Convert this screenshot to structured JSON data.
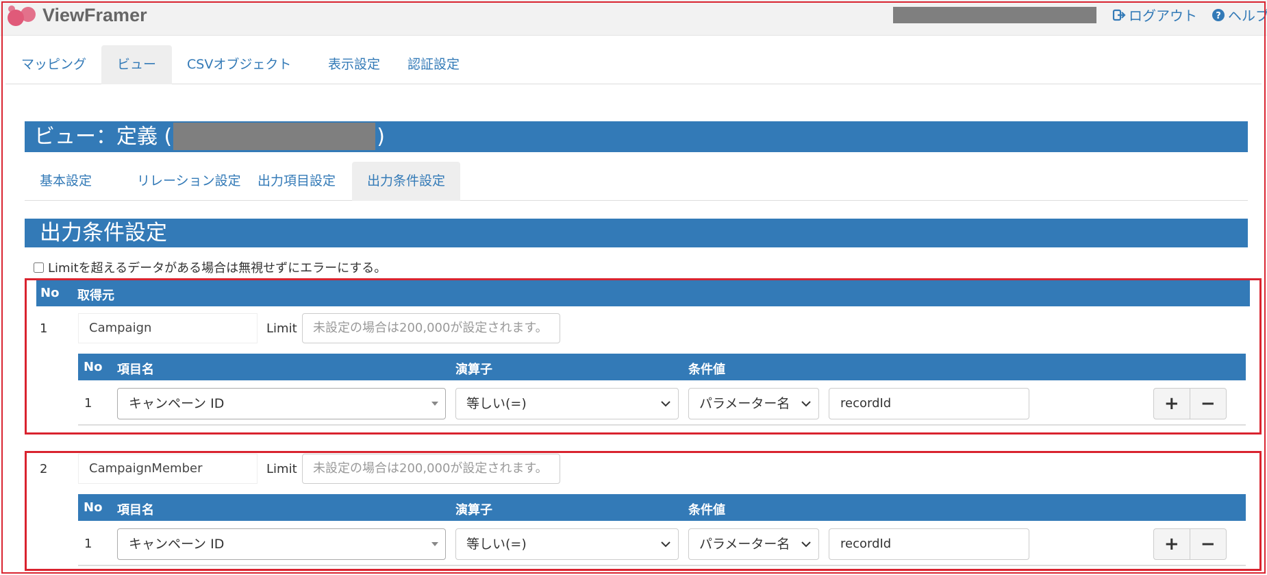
{
  "app": {
    "brand": "ViewFramer",
    "logout": "ログアウト",
    "help": "ヘルプ"
  },
  "nav": {
    "tabs": [
      "マッピング",
      "ビュー",
      "CSVオブジェクト",
      "表示設定",
      "認証設定"
    ],
    "active": "ビュー"
  },
  "view_header": {
    "prefix": "ビュー：定義 (",
    "suffix": ")"
  },
  "subnav": {
    "tabs": [
      "基本設定",
      "リレーション設定",
      "出力項目設定",
      "出力条件設定"
    ],
    "active": "出力条件設定"
  },
  "section_title": "出力条件設定",
  "limit_error_option": {
    "label": "Limitを超えるデータがある場合は無視せずにエラーにする。",
    "checked": false
  },
  "table_headers": {
    "no": "No",
    "source": "取得元"
  },
  "condition_headers": {
    "no": "No",
    "field": "項目名",
    "operator": "演算子",
    "value": "条件値"
  },
  "limit_label": "Limit",
  "limit_placeholder": "未設定の場合は200,000が設定されます。",
  "sources": [
    {
      "no": "1",
      "name": "Campaign",
      "conditions": [
        {
          "no": "1",
          "field": "キャンペーン ID",
          "operator": "等しい(=)",
          "value_type": "パラメーター名",
          "value": "recordId"
        }
      ]
    },
    {
      "no": "2",
      "name": "CampaignMember",
      "conditions": [
        {
          "no": "1",
          "field": "キャンペーン ID",
          "operator": "等しい(=)",
          "value_type": "パラメーター名",
          "value": "recordId"
        }
      ]
    }
  ],
  "buttons": {
    "add": "+",
    "remove": "−"
  },
  "colors": {
    "primary": "#337ab7",
    "highlight_border": "#d9232f",
    "logo": "#e05a79"
  }
}
